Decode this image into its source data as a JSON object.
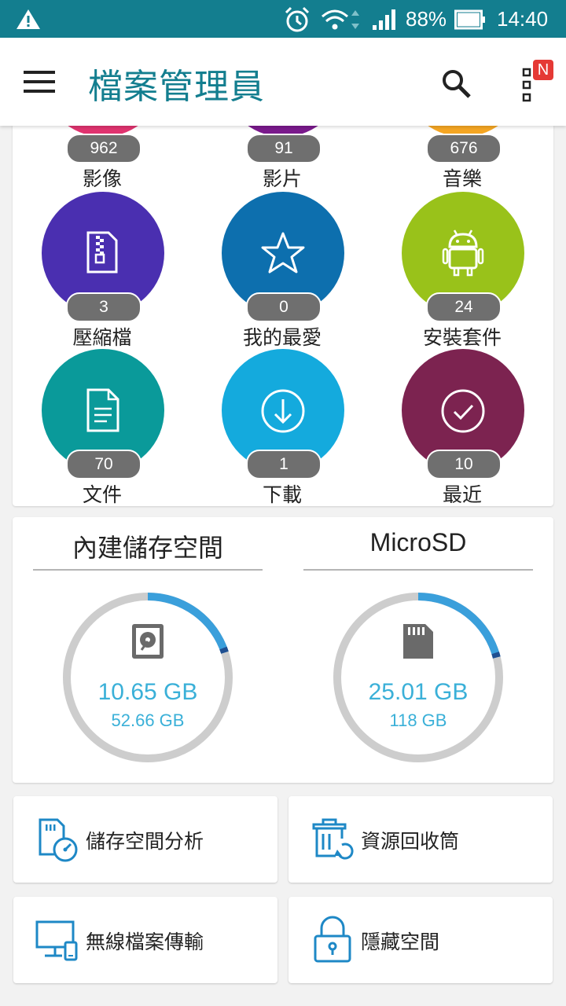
{
  "status_bar": {
    "battery": "88%",
    "time": "14:40"
  },
  "app_bar": {
    "title": "檔案管理員",
    "notification_badge": "N"
  },
  "categories": [
    {
      "label": "影像",
      "count": "962",
      "color": "#e0336f",
      "icon": "image-icon"
    },
    {
      "label": "影片",
      "count": "91",
      "color": "#7a1a8c",
      "icon": "video-icon"
    },
    {
      "label": "音樂",
      "count": "676",
      "color": "#f5a623",
      "icon": "music-icon"
    },
    {
      "label": "壓縮檔",
      "count": "3",
      "color": "#4a2fb0",
      "icon": "zip-file-icon"
    },
    {
      "label": "我的最愛",
      "count": "0",
      "color": "#0d6fae",
      "icon": "star-icon"
    },
    {
      "label": "安裝套件",
      "count": "24",
      "color": "#99c21a",
      "icon": "android-icon"
    },
    {
      "label": "文件",
      "count": "70",
      "color": "#0a9a9a",
      "icon": "document-icon"
    },
    {
      "label": "下載",
      "count": "1",
      "color": "#14aadd",
      "icon": "download-icon"
    },
    {
      "label": "最近",
      "count": "10",
      "color": "#7c2350",
      "icon": "check-circle-icon"
    }
  ],
  "storage": [
    {
      "title": "內建儲存空間",
      "used": "10.65 GB",
      "total": "52.66 GB",
      "used_fraction": 0.2,
      "icon": "hard-drive-icon"
    },
    {
      "title": "MicroSD",
      "used": "25.01 GB",
      "total": "118 GB",
      "used_fraction": 0.21,
      "icon": "sd-card-icon"
    }
  ],
  "tools": [
    {
      "label": "儲存空間分析",
      "icon": "storage-analyzer-icon"
    },
    {
      "label": "資源回收筒",
      "icon": "recycle-bin-icon"
    },
    {
      "label": "無線檔案傳輸",
      "icon": "wireless-transfer-icon"
    },
    {
      "label": "隱藏空間",
      "icon": "lock-icon"
    }
  ],
  "colors": {
    "primary": "#137e8f",
    "accent": "#3ab0d8",
    "badge": "#e53935"
  }
}
